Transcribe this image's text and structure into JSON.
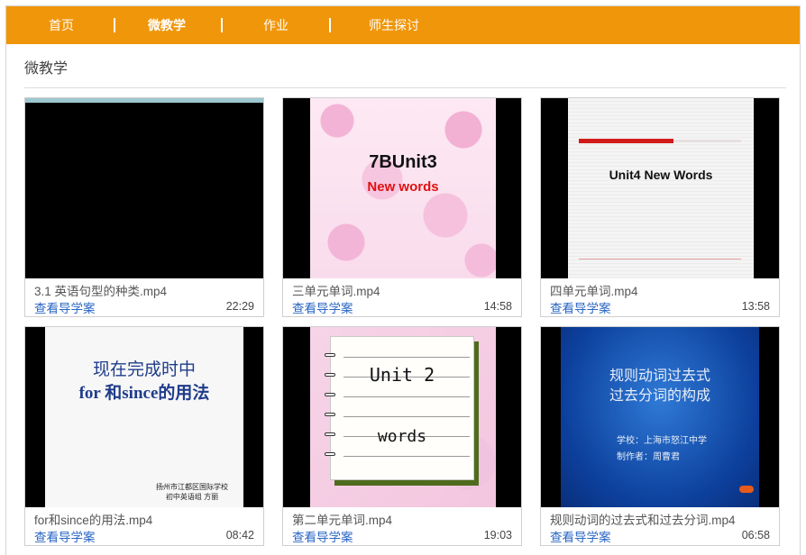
{
  "nav": {
    "items": [
      {
        "label": "首页",
        "active": false
      },
      {
        "label": "微教学",
        "active": true
      },
      {
        "label": "作业",
        "active": false
      },
      {
        "label": "师生探讨",
        "active": false
      }
    ],
    "separator": "|"
  },
  "section": {
    "title": "微教学"
  },
  "videos": [
    {
      "title": "3.1 英语句型的种类.mp4",
      "link": "查看导学案",
      "duration": "22:29"
    },
    {
      "title": "三单元单词.mp4",
      "link": "查看导学案",
      "duration": "14:58",
      "thumb_text": [
        "7BUnit3",
        "New words"
      ]
    },
    {
      "title": "四单元单词.mp4",
      "link": "查看导学案",
      "duration": "13:58",
      "thumb_text": [
        "Unit4 New Words"
      ]
    },
    {
      "title": "for和since的用法.mp4",
      "link": "查看导学案",
      "duration": "08:42",
      "thumb_text": [
        "现在完成时中",
        "for 和since的用法",
        "扬州市江都区国际学校",
        "初中英语组  方丽"
      ]
    },
    {
      "title": "第二单元单词.mp4",
      "link": "查看导学案",
      "duration": "19:03",
      "thumb_text": [
        "Unit 2",
        "words"
      ]
    },
    {
      "title": "规则动词的过去式和过去分词.mp4",
      "link": "查看导学案",
      "duration": "06:58",
      "thumb_text": [
        "规则动词过去式",
        "过去分词的构成",
        "学校：上海市怒江中学",
        "制作者：周曹君"
      ]
    }
  ],
  "colors": {
    "nav_bg": "#f0960a",
    "link": "#2a66c4"
  }
}
